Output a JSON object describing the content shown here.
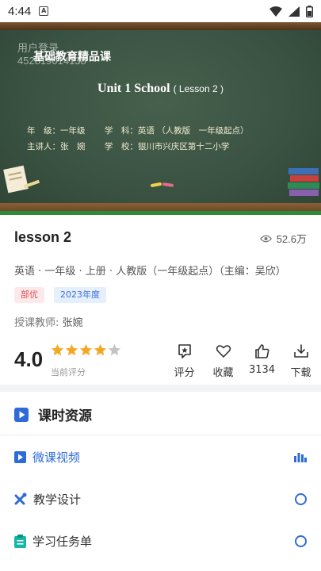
{
  "status_bar": {
    "time": "4:44"
  },
  "video": {
    "watermark_line1": "用户登录",
    "watermark_line2": "452819014138",
    "course_title": "基础教育精品课",
    "unit_title": "Unit 1 School",
    "unit_subtitle": "( Lesson 2 )",
    "info_line1": "年　级：一年级　　 学　科：英语 （人教版　一年级起点）",
    "info_line2": "主讲人：张　婉　　 学　校：银川市兴庆区第十二小学"
  },
  "lesson": {
    "title": "lesson 2",
    "views": "52.6万",
    "meta": "英语 · 一年级 · 上册 · 人教版（一年级起点）（主编：吴欣）",
    "tags": [
      "部优",
      "2023年度"
    ],
    "teacher_label": "授课教师:",
    "teacher_name": "张婉",
    "rating": "4.0",
    "rating_label": "当前评分",
    "stars_filled": 4,
    "stars_total": 5
  },
  "actions": [
    {
      "icon": "rate-icon",
      "label": "评分"
    },
    {
      "icon": "heart-icon",
      "label": "收藏"
    },
    {
      "icon": "thumbs-up-icon",
      "label": "3134"
    },
    {
      "icon": "download-icon",
      "label": "下载"
    }
  ],
  "resources": {
    "header": "课时资源",
    "items": [
      {
        "label": "微课视频",
        "state": "playing"
      },
      {
        "label": "教学设计",
        "state": "idle"
      },
      {
        "label": "学习任务单",
        "state": "idle"
      }
    ]
  },
  "colors": {
    "accent": "#2f6bd8",
    "star": "#f5a623",
    "tag_red": "#e0515a",
    "chalkboard": "#3a5242"
  }
}
